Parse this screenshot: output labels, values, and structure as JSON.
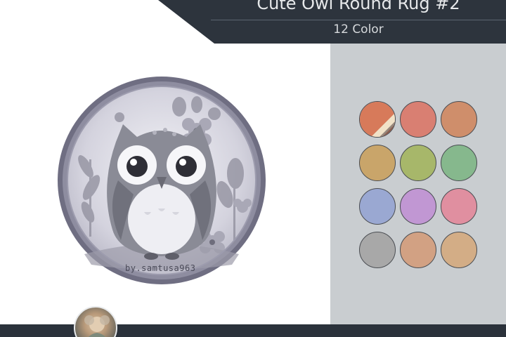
{
  "header": {
    "title": "Cute Owl Round Rug #2",
    "subtitle": "12 Color"
  },
  "rug": {
    "signature": "by.samtusa963",
    "colors": {
      "frame": "#7b7a8c",
      "inner": "#c8c7d4",
      "owl_body": "#8e8f99",
      "owl_belly": "#eeeef2"
    }
  },
  "swatches": [
    {
      "name": "original-multicolor",
      "colors": [
        "#d77a5a",
        "#f1e2c8",
        "#5a4a48"
      ]
    },
    {
      "name": "salmon",
      "color": "#d97f72"
    },
    {
      "name": "terracotta",
      "color": "#cf8e6b"
    },
    {
      "name": "mustard",
      "color": "#c9a56a"
    },
    {
      "name": "olive-green",
      "color": "#a7b76a"
    },
    {
      "name": "sage-green",
      "color": "#86b88d"
    },
    {
      "name": "periwinkle",
      "color": "#9aa8d2"
    },
    {
      "name": "lilac",
      "color": "#c197d3"
    },
    {
      "name": "pink",
      "color": "#e08fa0"
    },
    {
      "name": "gray",
      "color": "#a8a8a8"
    },
    {
      "name": "peach",
      "color": "#d2a183"
    },
    {
      "name": "sand",
      "color": "#d3ad86"
    }
  ],
  "theme": {
    "header_dark": "#2d343d",
    "panel_bg": "#c9cdd0",
    "footer_dark": "#2b323b"
  }
}
